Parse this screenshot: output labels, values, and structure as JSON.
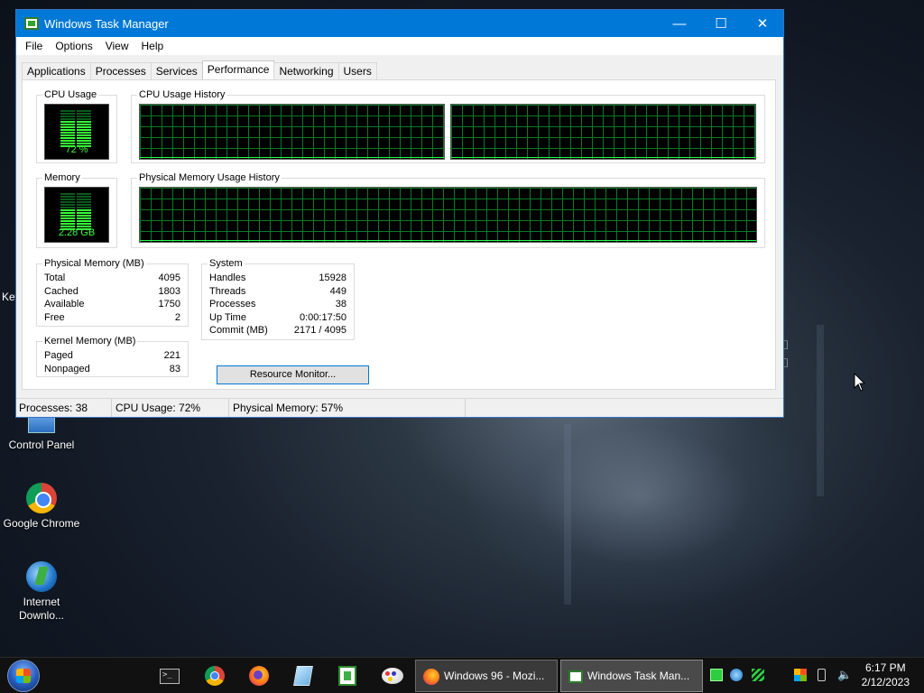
{
  "desktop": {
    "left_fragment": "Key",
    "icons": [
      {
        "label": "Control Panel",
        "icon": "control-panel-icon"
      },
      {
        "label": "Google Chrome",
        "icon": "chrome-icon"
      },
      {
        "label": "Internet Downlo...",
        "icon": "internet-download-manager-icon"
      }
    ]
  },
  "window": {
    "title": "Windows Task Manager",
    "controls": {
      "minimize": "—",
      "maximize": "☐",
      "close": "✕"
    },
    "menu": [
      "File",
      "Options",
      "View",
      "Help"
    ],
    "tabs": [
      "Applications",
      "Processes",
      "Services",
      "Performance",
      "Networking",
      "Users"
    ],
    "active_tab": "Performance",
    "performance": {
      "cpu_usage_title": "CPU Usage",
      "cpu_usage_value": "72 %",
      "cpu_usage_percent": 72,
      "cpu_history_title": "CPU Usage History",
      "memory_title": "Memory",
      "memory_value": "2.28 GB",
      "memory_percent": 57,
      "memory_history_title": "Physical Memory Usage History",
      "physical_memory": {
        "title": "Physical Memory (MB)",
        "rows": [
          {
            "label": "Total",
            "value": "4095"
          },
          {
            "label": "Cached",
            "value": "1803"
          },
          {
            "label": "Available",
            "value": "1750"
          },
          {
            "label": "Free",
            "value": "2"
          }
        ]
      },
      "kernel_memory": {
        "title": "Kernel Memory (MB)",
        "rows": [
          {
            "label": "Paged",
            "value": "221"
          },
          {
            "label": "Nonpaged",
            "value": "83"
          }
        ]
      },
      "system": {
        "title": "System",
        "rows": [
          {
            "label": "Handles",
            "value": "15928"
          },
          {
            "label": "Threads",
            "value": "449"
          },
          {
            "label": "Processes",
            "value": "38"
          },
          {
            "label": "Up Time",
            "value": "0:00:17:50"
          },
          {
            "label": "Commit (MB)",
            "value": "2171 / 4095"
          }
        ]
      },
      "resource_monitor_label": "Resource Monitor..."
    },
    "status": {
      "processes": "Processes: 38",
      "cpu": "CPU Usage: 72%",
      "memory": "Physical Memory: 57%"
    }
  },
  "taskbar": {
    "pinned": [
      "cmd-icon",
      "chrome-icon",
      "firefox-icon",
      "notepad-icon",
      "excel-icon",
      "paint-icon"
    ],
    "tasks": [
      {
        "label": "Windows 96 - Mozi...",
        "icon": "firefox-icon",
        "active": false
      },
      {
        "label": "Windows Task Man...",
        "icon": "task-manager-icon",
        "active": true
      }
    ],
    "clock_time": "6:17 PM",
    "clock_date": "2/12/2023"
  },
  "colors": {
    "titlebar": "#0078d7",
    "meter_green": "#39ff39",
    "grid_green": "#0b7a26",
    "taskbar": "#111111"
  }
}
